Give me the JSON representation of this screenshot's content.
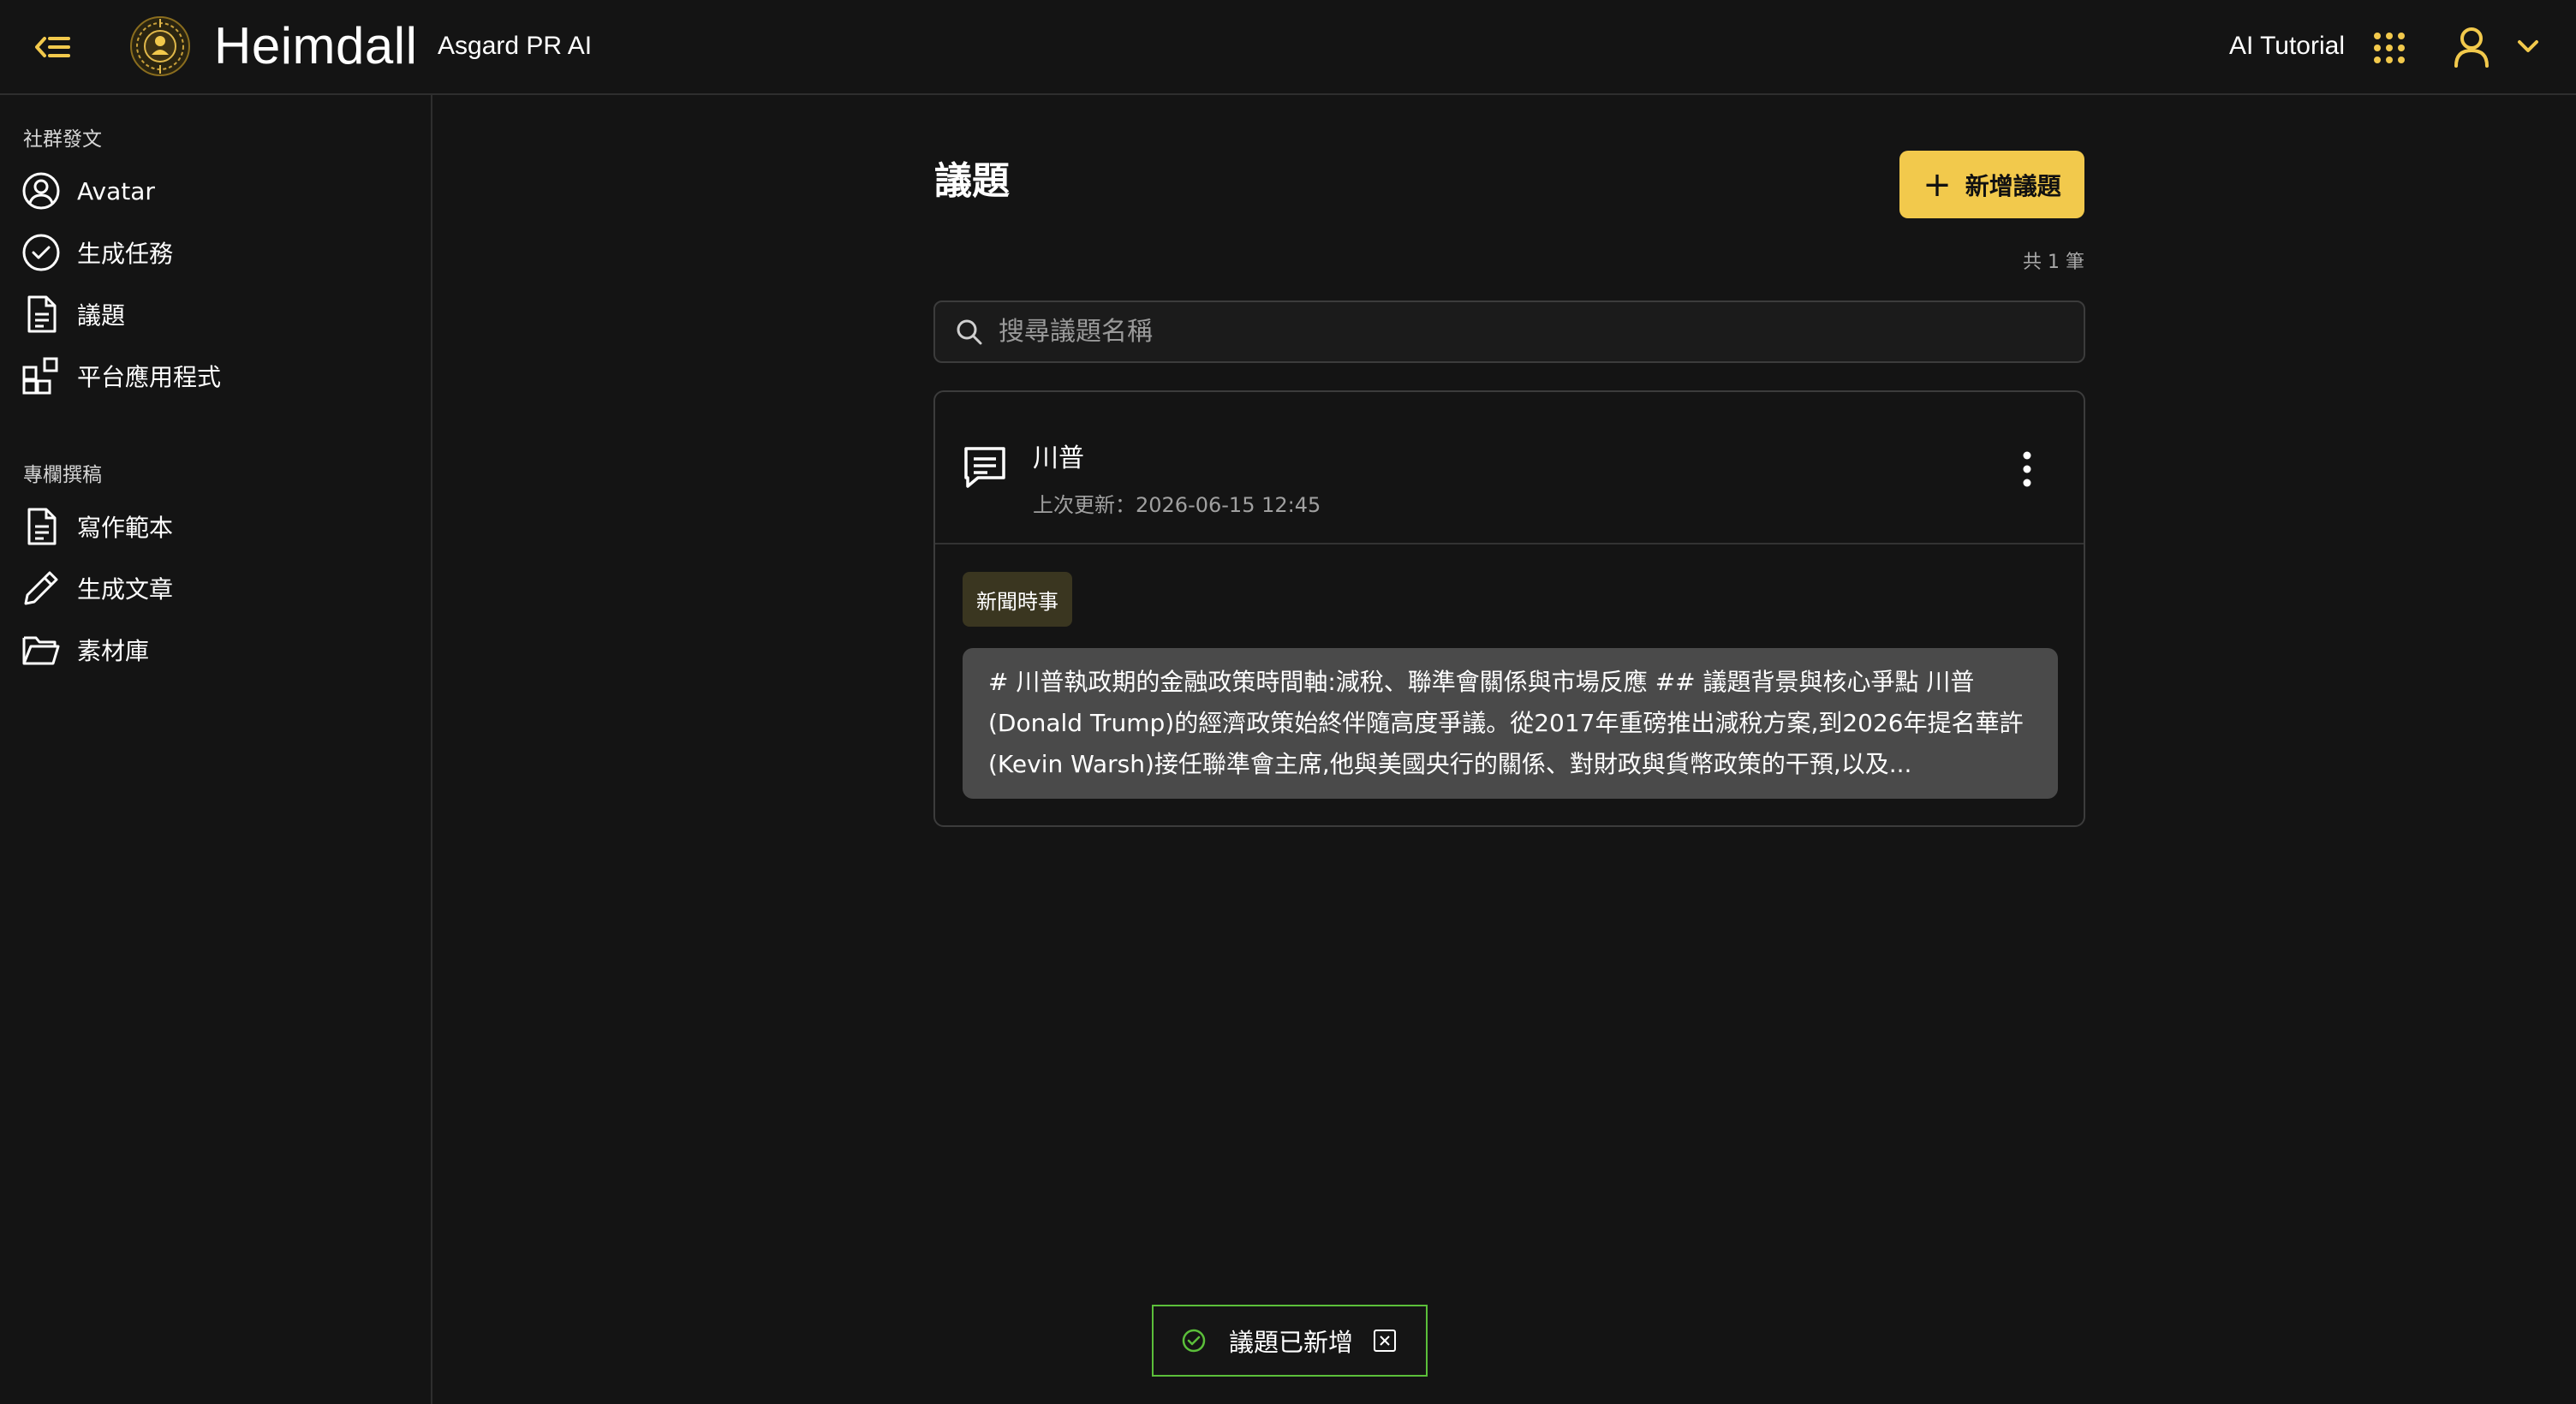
{
  "header": {
    "brand": "Heimdall",
    "subtitle": "Asgard PR AI",
    "tutorial_label": "AI Tutorial"
  },
  "colors": {
    "accent": "#f2c94c",
    "success": "#5bbf3a",
    "background": "#141414",
    "tag_bg": "#3a3620"
  },
  "sidebar": {
    "sections": [
      {
        "title": "社群發文",
        "items": [
          {
            "label": "Avatar",
            "icon": "user-circle-icon"
          },
          {
            "label": "生成任務",
            "icon": "check-circle-icon"
          },
          {
            "label": "議題",
            "icon": "document-icon"
          },
          {
            "label": "平台應用程式",
            "icon": "apps-icon"
          }
        ]
      },
      {
        "title": "專欄撰稿",
        "items": [
          {
            "label": "寫作範本",
            "icon": "document-icon"
          },
          {
            "label": "生成文章",
            "icon": "pencil-icon"
          },
          {
            "label": "素材庫",
            "icon": "folder-icon"
          }
        ]
      }
    ]
  },
  "main": {
    "title": "議題",
    "add_button_label": "新增議題",
    "count_text": "共 1 筆",
    "search_placeholder": "搜尋議題名稱",
    "topics": [
      {
        "title": "川普",
        "updated": "上次更新：2026-06-15 12:45",
        "tag": "新聞時事",
        "preview": "# 川普執政期的金融政策時間軸:減稅、聯準會關係與市場反應 ## 議題背景與核心爭點 川普(Donald Trump)的經濟政策始終伴隨高度爭議。從2017年重磅推出減稅方案,到2026年提名華許(Kevin Warsh)接任聯準會主席,他與美國央行的關係、對財政與貨幣政策的干預,以及..."
      }
    ]
  },
  "toast": {
    "message": "議題已新增"
  }
}
